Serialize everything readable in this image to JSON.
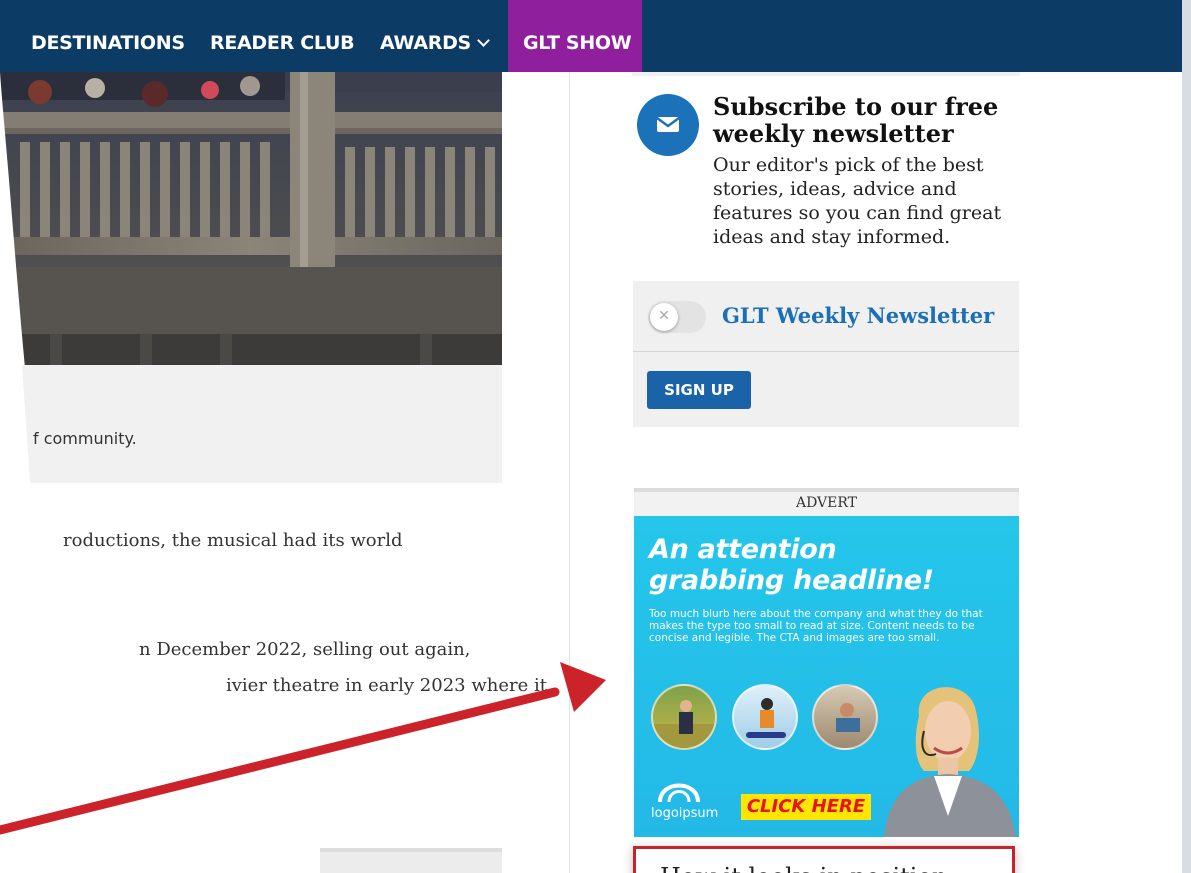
{
  "nav": {
    "items": [
      "DESTINATIONS",
      "READER CLUB",
      "AWARDS",
      "GLT SHOW"
    ],
    "show_color": "#8f1f9c",
    "bar_color": "#0c3c66"
  },
  "article": {
    "caption": "f community.",
    "paragraph1_line1": "roductions, the musical had its world",
    "paragraph2_line1": "n December 2022, selling out again,",
    "paragraph2_line2": "ivier theatre in early 2023 where it"
  },
  "newsletter": {
    "title": "Subscribe to our free weekly newsletter",
    "description": "Our editor's pick of the best stories, ideas, advice and features so you can find great ideas and stay informed.",
    "toggle_label": "GLT Weekly Newsletter",
    "signup_label": "SIGN UP",
    "icon": "mail-icon"
  },
  "advert": {
    "label": "ADVERT",
    "headline_line1": "An attention",
    "headline_line2": "grabbing headline!",
    "blurb": "Too much blurb here about the company and what they do that makes the type too small to read at size. Content needs to be concise and legible. The CTA and images are too small.",
    "logo_text": "logoipsum",
    "cta": "CLICK HERE"
  },
  "callout": {
    "text": "How it looks in position:"
  }
}
